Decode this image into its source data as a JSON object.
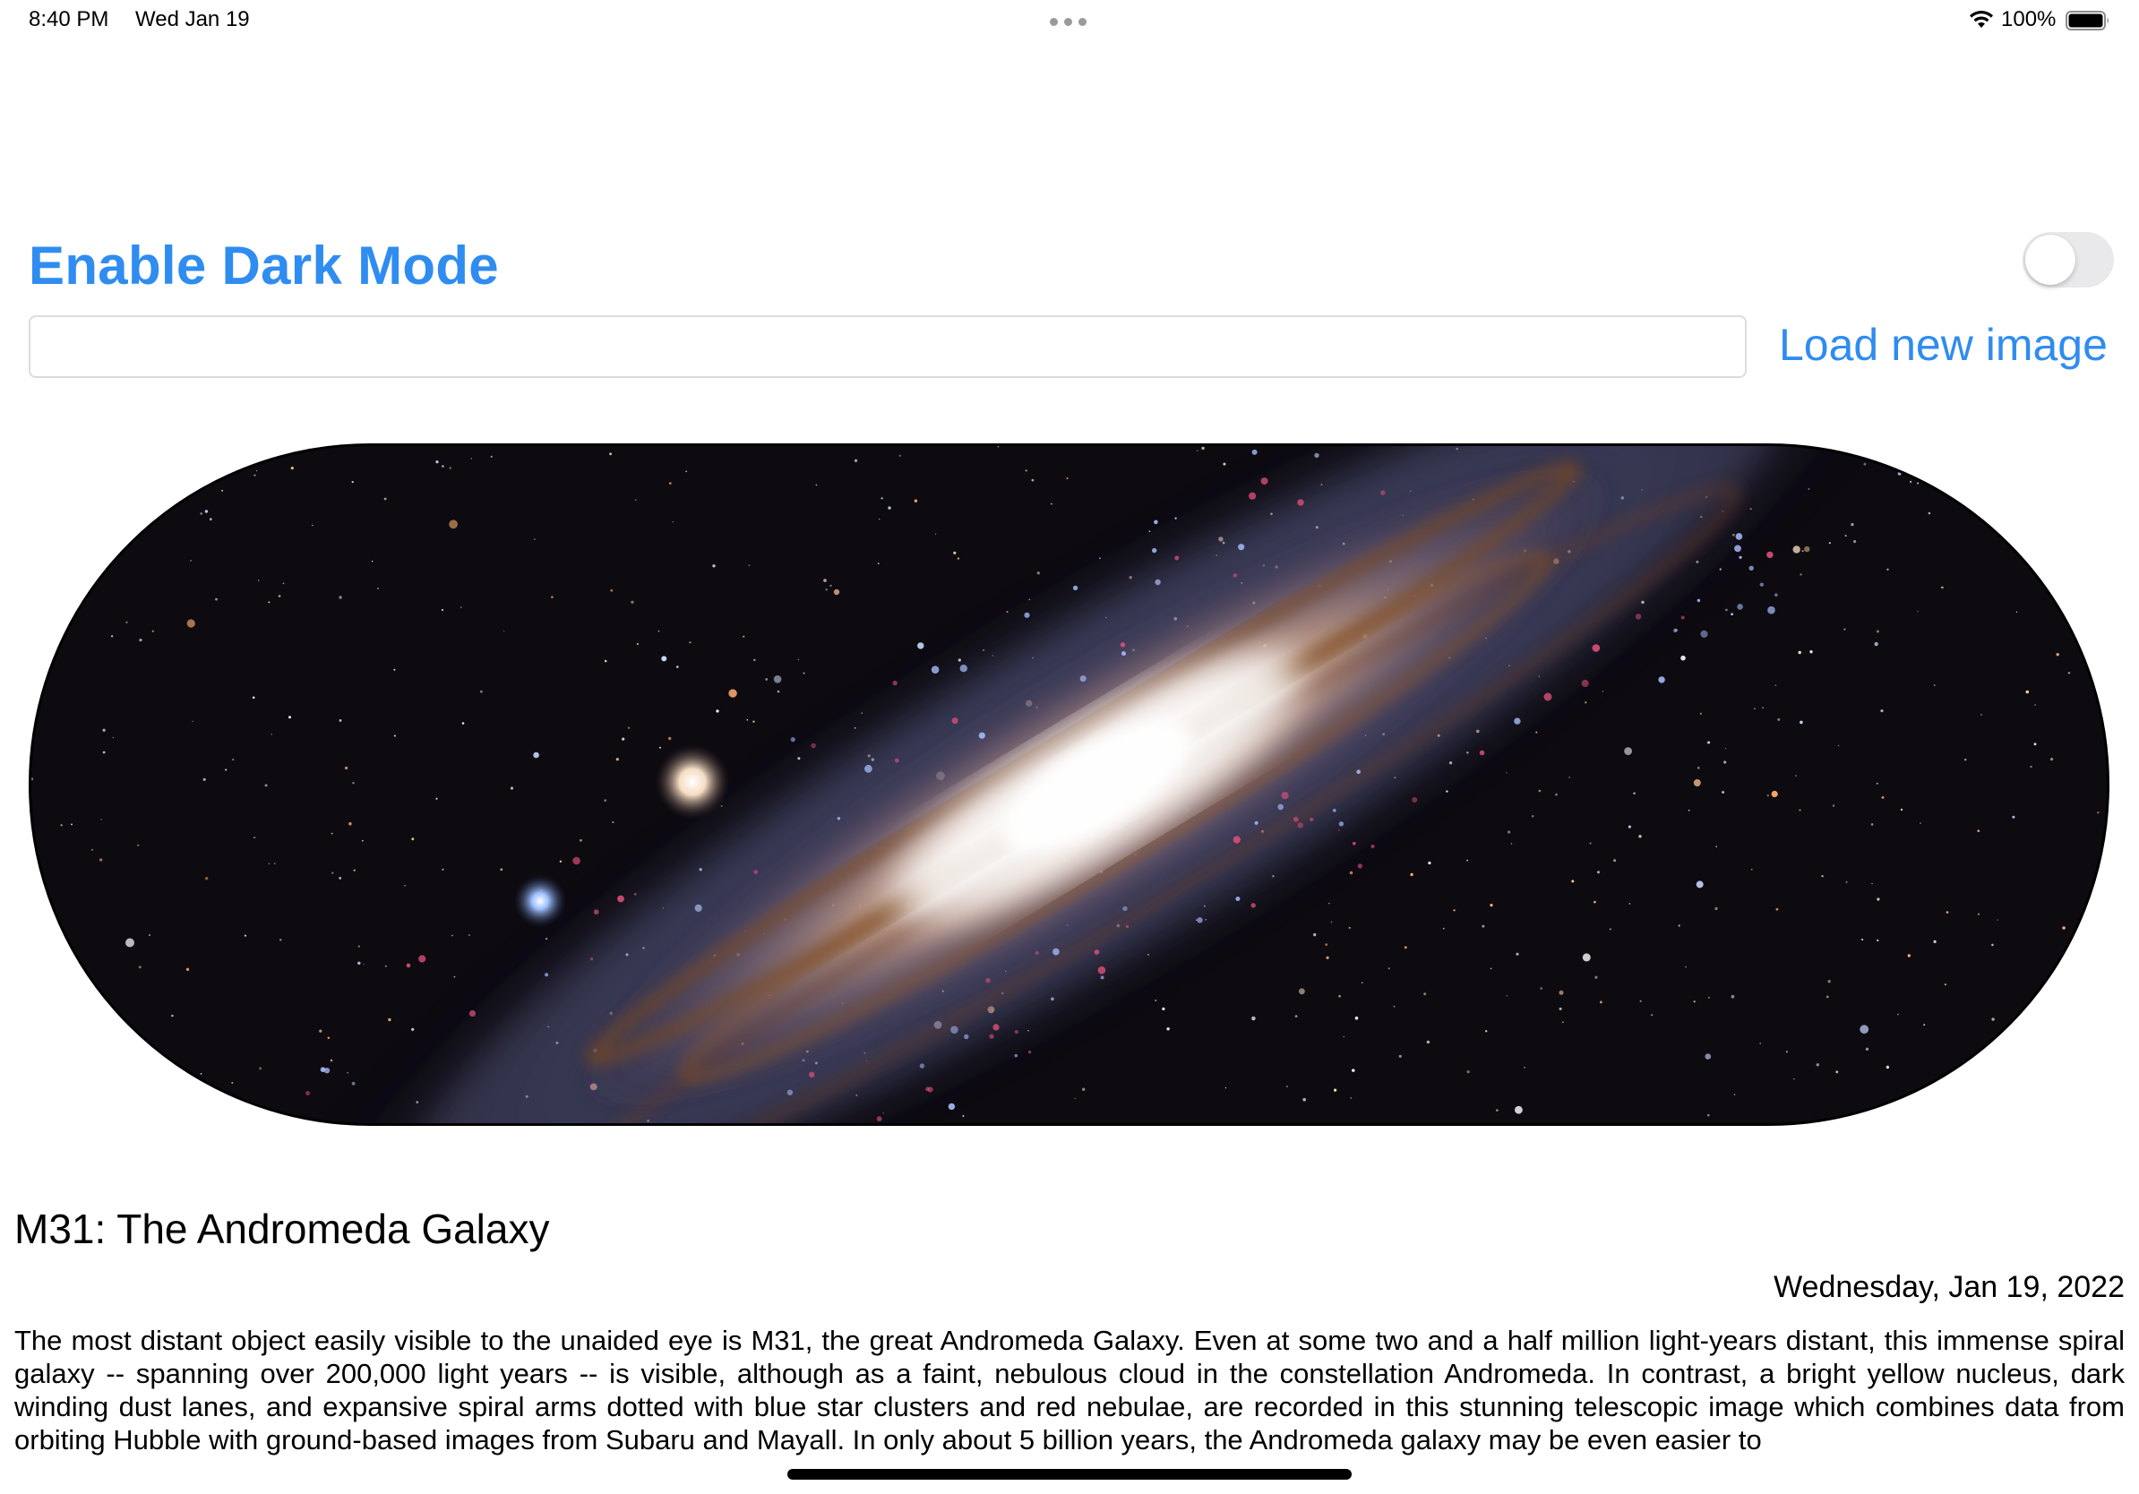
{
  "status_bar": {
    "time": "8:40 PM",
    "date": "Wed Jan 19",
    "battery_percent": "100%",
    "battery_level": 1.0
  },
  "settings": {
    "dark_mode_label": "Enable Dark Mode",
    "dark_mode_enabled": false
  },
  "image_loader": {
    "url_value": "",
    "url_placeholder": "",
    "load_button_label": "Load new image"
  },
  "article": {
    "title": "M31: The Andromeda Galaxy",
    "date": "Wednesday, Jan 19, 2022",
    "body": "The most distant object easily visible to the unaided eye is M31, the great Andromeda Galaxy. Even at some two and a half million light-years distant, this immense spiral galaxy -- spanning over 200,000 light years -- is visible, although as a faint, nebulous cloud in the constellation Andromeda. In contrast, a bright yellow nucleus, dark winding dust lanes, and expansive spiral arms dotted with blue star clusters and red nebulae, are recorded in this stunning telescopic image which combines data from orbiting Hubble with ground-based images from Subaru and Mayall. In only about 5 billion years, the Andromeda galaxy may be even easier to"
  },
  "colors": {
    "accent": "#2f8cf0",
    "toggle_off": "#e9e9eb"
  }
}
